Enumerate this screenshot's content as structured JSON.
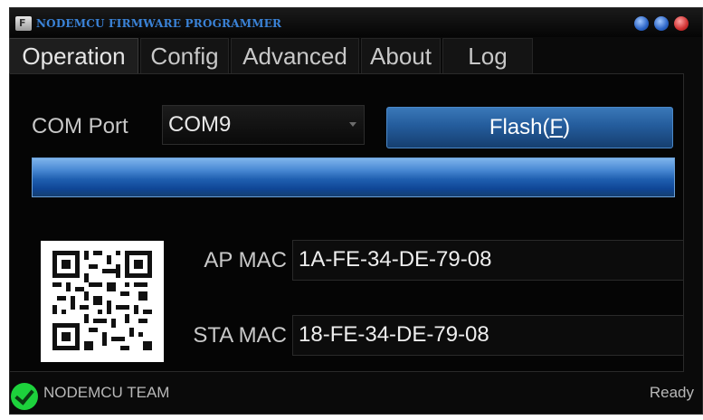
{
  "window": {
    "title": "NODEMCU FIRMWARE PROGRAMMER",
    "app_icon_glyph": "F"
  },
  "tabs": [
    {
      "label": "Operation",
      "active": true
    },
    {
      "label": "Config",
      "active": false
    },
    {
      "label": "Advanced",
      "active": false
    },
    {
      "label": "About",
      "active": false
    },
    {
      "label": "Log",
      "active": false
    }
  ],
  "operation": {
    "com_port_label": "COM Port",
    "com_port_value": "COM9",
    "flash_label_prefix": "Flash(",
    "flash_hotkey": "F",
    "flash_label_suffix": ")",
    "progress": 1.0,
    "ap_mac_label": "AP MAC",
    "ap_mac_value": "1A-FE-34-DE-79-08",
    "sta_mac_label": "STA MAC",
    "sta_mac_value": "18-FE-34-DE-79-08"
  },
  "status": {
    "team": "NODEMCU TEAM",
    "state": "Ready",
    "icon": "check-circle-icon",
    "icon_color": "#1dd23c"
  },
  "colors": {
    "accent": "#245c9c",
    "title_text": "#3a82d6",
    "background": "#0a0a0a"
  }
}
